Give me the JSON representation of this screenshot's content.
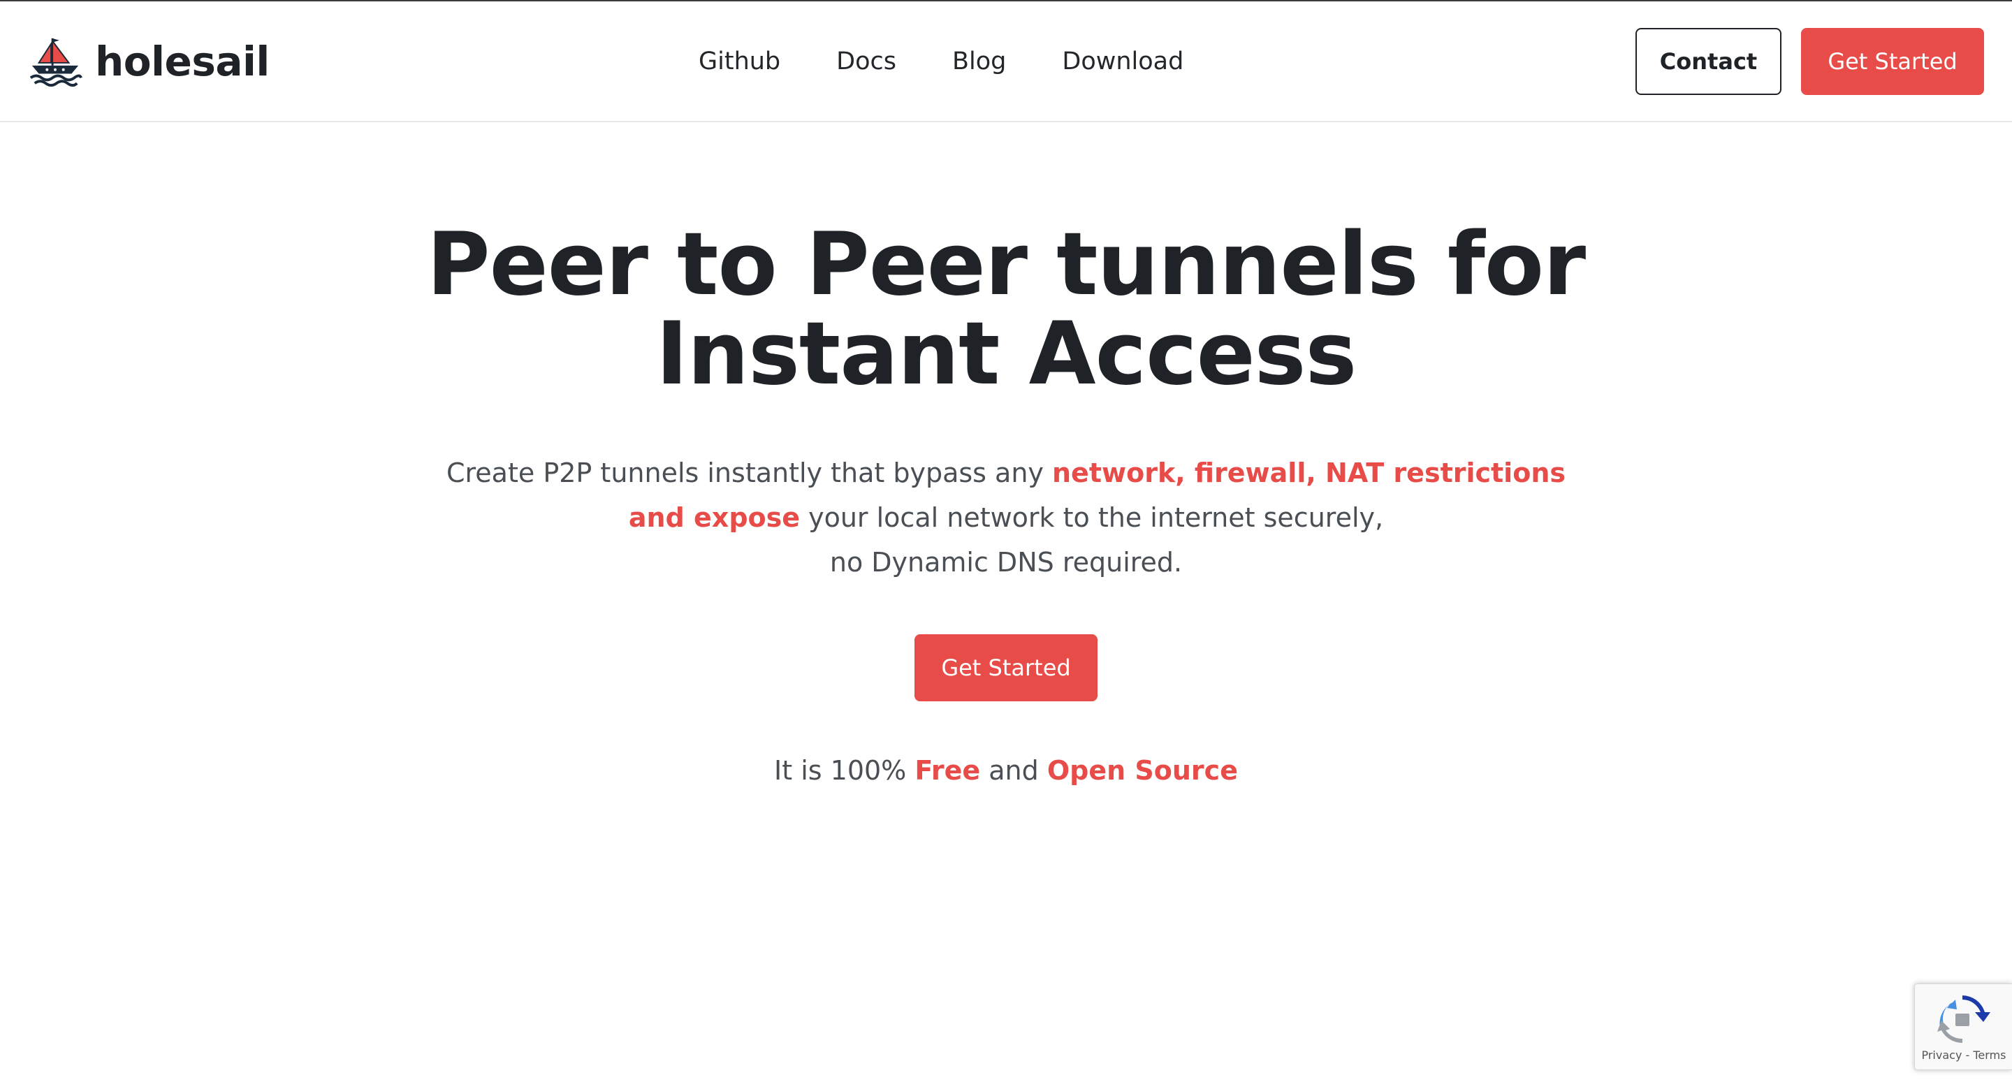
{
  "header": {
    "brand": {
      "name": "holesail",
      "logo": "sailboat-logo"
    },
    "nav": [
      {
        "label": "Github"
      },
      {
        "label": "Docs"
      },
      {
        "label": "Blog"
      },
      {
        "label": "Download"
      }
    ],
    "contact_label": "Contact",
    "get_started_label": "Get Started"
  },
  "hero": {
    "title_line1": "Peer to Peer tunnels for",
    "title_line2": "Instant Access",
    "subtitle": {
      "part1": "Create P2P tunnels instantly that bypass any ",
      "accent1": "network, firewall, NAT restrictions",
      "accent2": "and expose",
      "part2": " your local network to the internet securely,",
      "part3": "no Dynamic DNS required."
    },
    "cta_label": "Get Started",
    "footnote": {
      "part1": "It is 100% ",
      "accent1": "Free",
      "part2": " and ",
      "accent2": "Open Source"
    }
  },
  "recaptcha": {
    "privacy": "Privacy",
    "separator": " - ",
    "terms": "Terms",
    "icon": "recaptcha-icon"
  },
  "colors": {
    "accent": "#e84c48",
    "text": "#1f2328",
    "muted_text": "#4a4f55"
  }
}
